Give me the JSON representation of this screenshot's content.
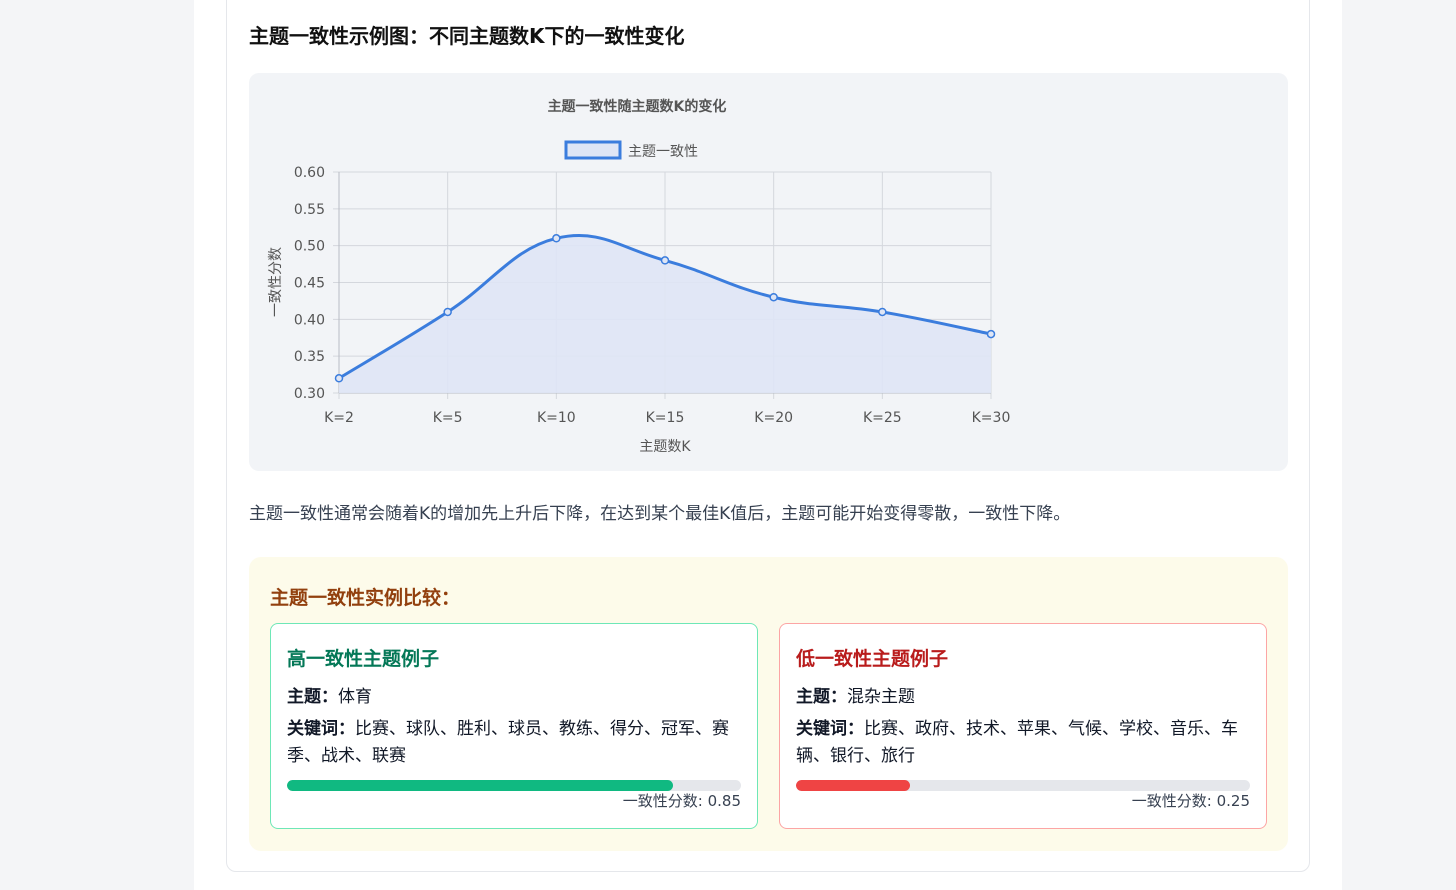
{
  "section_title": "主题一致性示例图：不同主题数K下的一致性变化",
  "chart_data": {
    "type": "line",
    "title": "主题一致性随主题数K的变化",
    "categories": [
      "K=2",
      "K=5",
      "K=10",
      "K=15",
      "K=20",
      "K=25",
      "K=30"
    ],
    "series": [
      {
        "name": "主题一致性",
        "values": [
          0.32,
          0.41,
          0.51,
          0.48,
          0.43,
          0.41,
          0.38
        ]
      }
    ],
    "xlabel": "主题数K",
    "ylabel": "一致性分数",
    "ylim": [
      0.3,
      0.6
    ],
    "yticks": [
      "0.60",
      "0.55",
      "0.50",
      "0.45",
      "0.40",
      "0.35",
      "0.30"
    ],
    "grid": true,
    "legend_position": "top",
    "colors": {
      "line": "#3b7ddd",
      "fill": "#dfe6f5"
    }
  },
  "description": "主题一致性通常会随着K的增加先上升后下降，在达到某个最佳K值后，主题可能开始变得零散，一致性下降。",
  "comparison": {
    "title": "主题一致性实例比较：",
    "high": {
      "title": "高一致性主题例子",
      "topic_label": "主题：",
      "topic_value": "体育",
      "keywords_label": "关键词：",
      "keywords_value": "比赛、球队、胜利、球员、教练、得分、冠军、赛季、战术、联赛",
      "score_text": "一致性分数: 0.85",
      "score": 0.85,
      "color": "#10b981"
    },
    "low": {
      "title": "低一致性主题例子",
      "topic_label": "主题：",
      "topic_value": "混杂主题",
      "keywords_label": "关键词：",
      "keywords_value": "比赛、政府、技术、苹果、气候、学校、音乐、车辆、银行、旅行",
      "score_text": "一致性分数: 0.25",
      "score": 0.25,
      "color": "#ef4444"
    }
  }
}
